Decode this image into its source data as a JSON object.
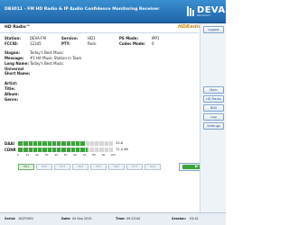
{
  "header": {
    "title": "DB3011 - FM HD Radio & IP Audio Confidence Monitoring Receiver",
    "brand": "DEVA",
    "brand_sub": "BROADCAST"
  },
  "subhead": {
    "section": "HD Radio™",
    "badge": "HDRadio"
  },
  "station": {
    "station_label": "Station:",
    "station_value": "DEVA-FM",
    "service_label": "Service:",
    "service_value": "HD1",
    "ps_label": "PS Mode:",
    "ps_value": "MP1",
    "fccid_label": "FCCID:",
    "fccid_value": "12345",
    "pty_label": "PTY:",
    "pty_value": "Rock",
    "codec_label": "Codec Mode:",
    "codec_value": "0"
  },
  "info": {
    "slogan_label": "Slogan:",
    "slogan_value": "Today's Best Music",
    "message_label": "Message:",
    "message_value": "#1 Hit Music Station in Town",
    "longname_label": "Long Name:",
    "longname_value": "Today's Best Music",
    "universal_label": "Universal",
    "shortname_label": "Short Name:"
  },
  "track": {
    "artist_label": "Artist:",
    "title_label": "Title:",
    "album_label": "Album:",
    "genre_label": "Genre:"
  },
  "meters": {
    "daai_label": "DAAI",
    "daai_value": "23.8",
    "cdnr_label": "CDNR",
    "cdnr_value": "72.4 dB",
    "daai_fraction": 0.7,
    "cdnr_fraction": 0.73,
    "scale": [
      "0",
      "10",
      "20",
      "30",
      "40",
      "50",
      "60",
      "70",
      "80",
      "90",
      "100"
    ]
  },
  "hd_buttons": [
    "HD1",
    "HD2",
    "HD3",
    "HD4",
    "HD5",
    "HD6",
    "HD7",
    "HD8"
  ],
  "sidebar": {
    "logout": "Logout",
    "main": "Main",
    "hd": "HD Radio",
    "rds": "RDS",
    "log": "Log",
    "settings": "Settings"
  },
  "footer": {
    "serial_label": "Serial:",
    "serial_value": "1K2F0001",
    "date_label": "Date:",
    "date_value": "04 Sep 2015",
    "time_label": "Time:",
    "time_value": "09:23:40",
    "session_label": "Session:",
    "session_value": "03:41"
  },
  "colors": {
    "header": "#2a78bf",
    "meter_green": "#3da33d",
    "hd_badge": "#c98a10"
  }
}
